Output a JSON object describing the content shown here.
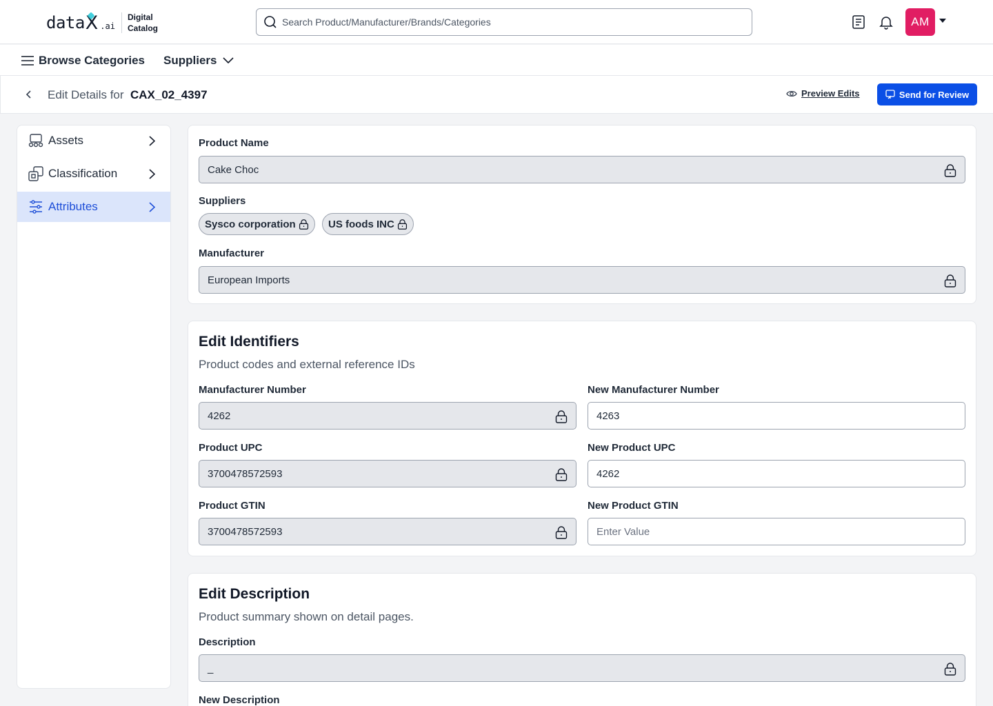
{
  "header": {
    "logo_word": "data",
    "logo_x": "X",
    "logo_ai": ".ai",
    "logo_sub": "Digital\nCatalog",
    "search_placeholder": "Search Product/Manufacturer/Brands/Categories",
    "avatar_initials": "AM",
    "avatar_color": "#e11d63"
  },
  "nav": {
    "browse_label": "Browse Categories",
    "suppliers_label": "Suppliers"
  },
  "titlebar": {
    "prefix": "Edit Details for",
    "product_id": "CAX_02_4397",
    "preview_label": "Preview Edits",
    "send_label": "Send for Review",
    "accent_color": "#0b4fe6"
  },
  "sidebar": {
    "items": [
      {
        "label": "Assets",
        "icon": "assets-icon",
        "active": false
      },
      {
        "label": "Classification",
        "icon": "classification-icon",
        "active": false
      },
      {
        "label": "Attributes",
        "icon": "sliders-icon",
        "active": true
      }
    ]
  },
  "product": {
    "name_label": "Product Name",
    "name_value": "Cake Choc",
    "suppliers_label": "Suppliers",
    "suppliers": [
      "Sysco corporation",
      "US foods INC"
    ],
    "manufacturer_label": "Manufacturer",
    "manufacturer_value": "European Imports"
  },
  "identifiers": {
    "title": "Edit Identifiers",
    "subtitle": "Product codes and external reference IDs",
    "manufacturer_number_label": "Manufacturer Number",
    "manufacturer_number_value": "4262",
    "new_manufacturer_number_label": "New Manufacturer Number",
    "new_manufacturer_number_value": "4263",
    "upc_label": "Product UPC",
    "upc_value": "3700478572593",
    "new_upc_label": "New Product UPC",
    "new_upc_value": "4262",
    "gtin_label": "Product GTIN",
    "gtin_value": "3700478572593",
    "new_gtin_label": "New Product GTIN",
    "new_gtin_placeholder": "Enter Value"
  },
  "description": {
    "title": "Edit Description",
    "subtitle": "Product summary shown on detail pages.",
    "description_label": "Description",
    "description_value": "_",
    "new_description_label": "New Description"
  }
}
